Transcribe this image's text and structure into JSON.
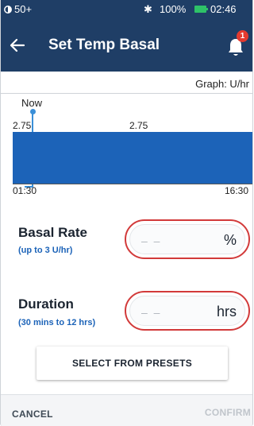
{
  "status_bar": {
    "left_text": "50+",
    "bluetooth_icon": "bluetooth-icon",
    "battery_percent": "100%",
    "time": "02:46"
  },
  "header": {
    "title": "Set Temp Basal",
    "back_icon": "back-arrow-icon",
    "notification_icon": "bell-icon",
    "notification_count": "1"
  },
  "graph": {
    "unit_label": "Graph: U/hr",
    "now_label": "Now",
    "rate_start": "2.75",
    "rate_mid": "2.75",
    "time_start": "01:30",
    "time_end": "16:30",
    "bar_color": "#1c63b8"
  },
  "basal_rate": {
    "title": "Basal Rate",
    "hint": "(up to 3 U/hr)",
    "placeholder": "– –",
    "unit": "%"
  },
  "duration": {
    "title": "Duration",
    "hint": "(30 mins to 12 hrs)",
    "placeholder": "– –",
    "unit": "hrs"
  },
  "presets_button": "SELECT FROM PRESETS",
  "footer": {
    "cancel": "CANCEL",
    "confirm": "CONFIRM"
  },
  "colors": {
    "header_bg": "#1f3e66",
    "accent_blue": "#1c63b8",
    "error_red": "#d23a3a"
  }
}
